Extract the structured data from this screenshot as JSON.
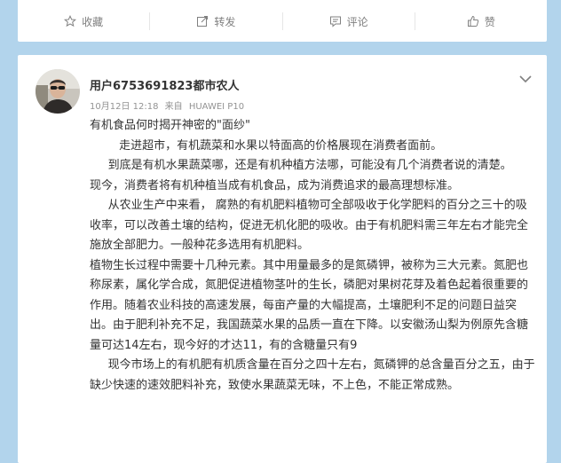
{
  "previous_post_actions": {
    "favorite_label": "收藏",
    "repost_label": "转发",
    "comment_label": "评论",
    "like_label": "赞"
  },
  "post": {
    "username": "用户6753691823都市农人",
    "date": "10月12日 12:18",
    "source_prefix": "来自",
    "source_device": "HUAWEI P10",
    "paragraphs": [
      "有机食品何时揭开神密的\"面纱\"",
      "        走进超市，有机蔬菜和水果以特面高的价格展现在消费者面前。",
      "     到底是有机水果蔬菜哪，还是有机种植方法哪，可能没有几个消费者说的清楚。",
      "现今，消费者将有机种植当成有机食品，成为消费追求的最高理想标准。",
      "     从农业生产中来看， 腐熟的有机肥料植物可全部吸收于化学肥料的百分之三十的吸收率，可以改善土壤的结构，促进无机化肥的吸收。由于有机肥料需三年左右才能完全施放全部肥力。一般种花多选用有机肥料。",
      "植物生长过程中需要十几种元素。其中用量最多的是氮磷钾，被称为三大元素。氮肥也称尿素，属化学合成，氮肥促进植物茎叶的生长，磷肥对果树花芽及着色起着很重要的作用。随着农业科技的高速发展，每亩产量的大幅提高，土壤肥利不足的问题日益突出。由于肥利补充不足，我国蔬菜水果的品质一直在下降。以安徽汤山梨为例原先含糖量可达14左右，现今好的才达11，有的含糖量只有9",
      "     现今市场上的有机肥有机质含量在百分之四十左右，氮磷钾的总含量百分之五，由于缺少快速的速效肥料补充，致使水果蔬菜无味，不上色，不能正常成熟。"
    ]
  }
}
